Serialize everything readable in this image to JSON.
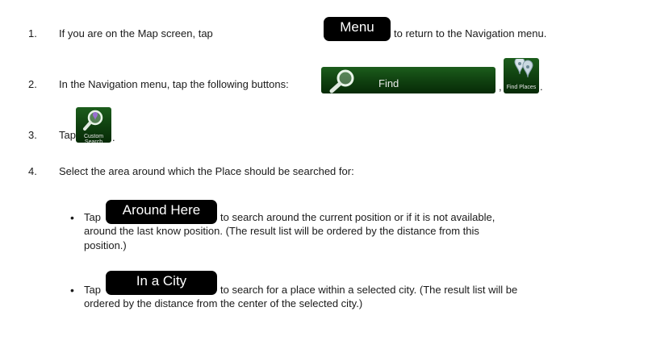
{
  "steps": [
    {
      "number": "1.",
      "before": "If you are on the Map screen, tap",
      "button": "Menu",
      "after": "to return to the Navigation menu."
    },
    {
      "number": "2.",
      "before": "In the Navigation menu, tap the following buttons:",
      "button1": "Find",
      "separator": ",",
      "button2": "Find Places",
      "end": "."
    },
    {
      "number": "3.",
      "before": "Tap",
      "button": "Custom Search",
      "end": "."
    },
    {
      "number": "4.",
      "text": "Select the area around which the Place should be searched for:"
    }
  ],
  "options": [
    {
      "bullet": "•",
      "tap": "Tap",
      "button": "Around Here",
      "line1": "to search around the current position or if it is not available,",
      "line2": "around the last know position. (The result list will be ordered by the distance from this",
      "line3": "position.)"
    },
    {
      "bullet": "•",
      "tap": "Tap",
      "button": "In a City",
      "line1": "to search for a place within a selected city. (The result list will be",
      "line2": "ordered by the distance from the center of the selected city.)"
    }
  ],
  "icons": {
    "find": "magnifier-icon",
    "find_places": "map-pins-icon",
    "custom_search": "magnifier-pin-icon"
  },
  "colors": {
    "button_black": "#000000",
    "button_green": "#1c5d1c",
    "text": "#1a1a1a"
  }
}
